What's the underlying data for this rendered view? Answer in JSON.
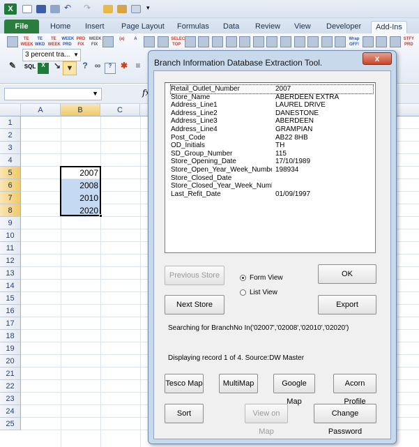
{
  "ribbon": {
    "tabs": [
      "File",
      "Home",
      "Insert",
      "Page Layout",
      "Formulas",
      "Data",
      "Review",
      "View",
      "Developer",
      "Add-Ins"
    ],
    "active_tab": "Add-Ins",
    "combo_value": "3 percent tra...",
    "row1_icons": [
      "tool-icon",
      "tool-icon",
      "tool-icon",
      "tool-icon",
      "tool-icon",
      "tool-icon",
      "tool-icon",
      "tool-icon",
      "tool-icon",
      "tool-icon",
      "tool-icon",
      "tool-icon",
      "tool-icon",
      "tool-icon",
      "tool-icon",
      "tool-icon",
      "tool-icon",
      "tool-icon",
      "tool-icon",
      "tool-icon",
      "tool-icon",
      "tool-icon",
      "tool-icon",
      "tool-icon",
      "tool-icon",
      "tool-icon",
      "tool-icon",
      "tool-icon",
      "tool-icon",
      "tool-icon",
      "tool-icon",
      "tool-icon"
    ],
    "row1_texts": [
      "",
      "TE WEEK",
      "TE WKD",
      "TE WEEK",
      "WEEK PRD",
      "PRD FIX",
      "WEEK FIX",
      "",
      "(a)",
      "A",
      "",
      "",
      "SELECT TOP",
      "",
      "",
      "",
      "",
      "",
      "",
      "",
      "",
      "",
      "",
      "",
      "",
      "Wrap OFF!",
      "",
      "",
      "",
      "STFY PRD"
    ]
  },
  "formula_bar": {
    "name_box": "",
    "fx_label": "fx"
  },
  "sheet": {
    "columns": [
      "A",
      "B",
      "C"
    ],
    "selected_column": "B",
    "rows": [
      "1",
      "2",
      "3",
      "4",
      "5",
      "6",
      "7",
      "8",
      "9",
      "10",
      "11",
      "12",
      "13",
      "14",
      "15",
      "16",
      "17",
      "18",
      "19",
      "20",
      "21",
      "22",
      "23",
      "24",
      "25"
    ],
    "selected_rows": [
      "5",
      "6",
      "7",
      "8"
    ],
    "cells_b": [
      {
        "row": "5",
        "value": "2007"
      },
      {
        "row": "6",
        "value": "2008"
      },
      {
        "row": "7",
        "value": "2010"
      },
      {
        "row": "8",
        "value": "2020"
      }
    ]
  },
  "dialog": {
    "title": "Branch Information Database Extraction Tool.",
    "close_label": "x",
    "record_fields": [
      {
        "key": "Retail_Outlet_Number",
        "value": "2007"
      },
      {
        "key": "Store_Name",
        "value": "ABERDEEN EXTRA"
      },
      {
        "key": "Address_Line1",
        "value": "LAUREL DRIVE"
      },
      {
        "key": "Address_Line2",
        "value": "DANESTONE"
      },
      {
        "key": "Address_Line3",
        "value": "ABERDEEN"
      },
      {
        "key": "Address_Line4",
        "value": "GRAMPIAN"
      },
      {
        "key": "Post_Code",
        "value": "AB22 8HB"
      },
      {
        "key": "OD_Initials",
        "value": "TH"
      },
      {
        "key": "SD_Group_Number",
        "value": "115"
      },
      {
        "key": "Store_Opening_Date",
        "value": "17/10/1989"
      },
      {
        "key": "Store_Open_Year_Week_Number",
        "value": "198934"
      },
      {
        "key": "Store_Closed_Date",
        "value": ""
      },
      {
        "key": "Store_Closed_Year_Week_Number",
        "value": ""
      },
      {
        "key": "Last_Refit_Date",
        "value": "01/09/1997"
      }
    ],
    "buttons": {
      "previous_store": "Previous Store",
      "next_store": "Next Store",
      "ok": "OK",
      "export": "Export",
      "tesco_map": "Tesco Map",
      "multimap": "MultiMap",
      "google_map": "Google Map",
      "acorn_profile": "Acorn Profile",
      "sort": "Sort",
      "view_on_map": "View on Map",
      "change_password": "Change Password"
    },
    "view_options": [
      {
        "label": "Form View",
        "selected": true
      },
      {
        "label": "List View",
        "selected": false
      }
    ],
    "search_text": "Searching for BranchNo In('02007','02008','02010','02020')",
    "status_text": "Displaying record 1 of 4.  Source:DW Master"
  }
}
